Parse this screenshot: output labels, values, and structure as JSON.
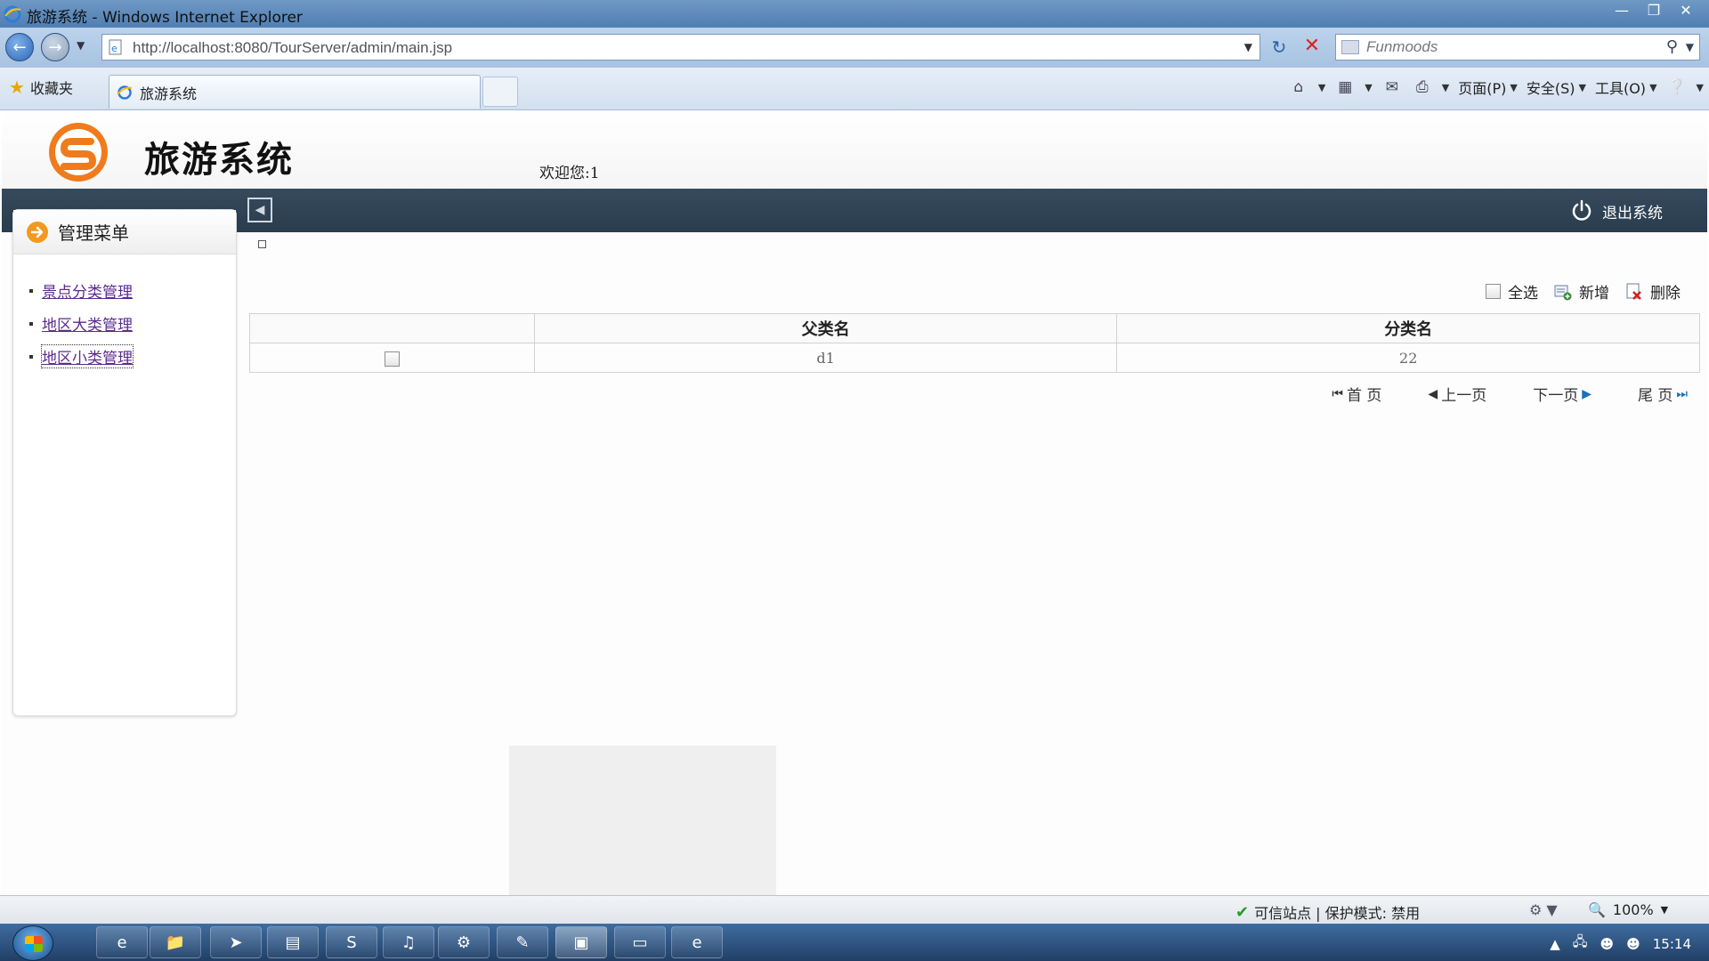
{
  "browser": {
    "window_title": "旅游系统 - Windows Internet Explorer",
    "url": "http://localhost:8080/TourServer/admin/main.jsp",
    "search_placeholder": "Funmoods",
    "favorites_label": "收藏夹",
    "tab_title": "旅游系统",
    "menus": [
      "页面(P)",
      "安全(S)",
      "工具(O)"
    ]
  },
  "site": {
    "title": "旅游系统",
    "welcome": "欢迎您:1",
    "logout_label": "退出系统"
  },
  "sidebar": {
    "heading": "管理菜单",
    "items": [
      {
        "label": "景点分类管理"
      },
      {
        "label": "地区大类管理"
      },
      {
        "label": "地区小类管理"
      }
    ]
  },
  "toolbar": {
    "select_all": "全选",
    "add": "新增",
    "delete": "删除"
  },
  "table": {
    "columns": [
      "",
      "父类名",
      "分类名"
    ],
    "rows": [
      {
        "parent": "d1",
        "name": "22"
      }
    ]
  },
  "pager": {
    "first": "首 页",
    "prev": "上一页",
    "next": "下一页",
    "last": "尾 页"
  },
  "status": {
    "zone": "可信站点 | 保护模式: 禁用",
    "zoom": "100%"
  },
  "taskbar": {
    "clock": "15:14"
  },
  "colors": {
    "nav_bar": "#2f4457",
    "link": "#5b2b8f",
    "logo": "#f07b1c"
  }
}
